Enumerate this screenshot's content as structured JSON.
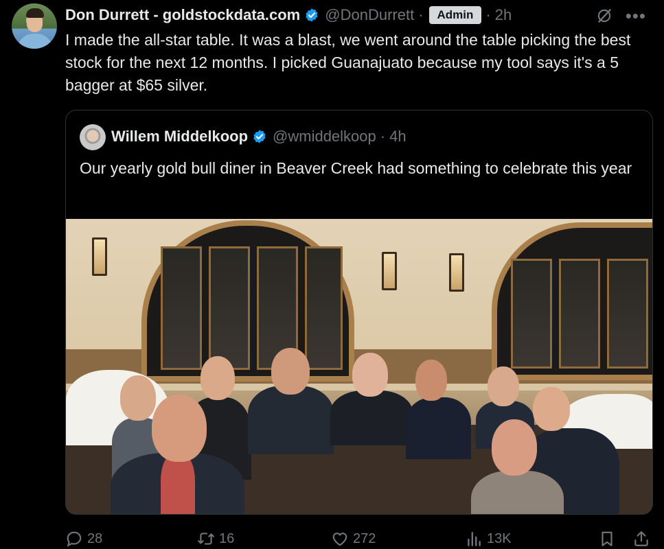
{
  "post": {
    "author_name": "Don Durrett - goldstockdata.com",
    "handle": "@DonDurrett",
    "badge": "Admin",
    "time": "2h",
    "text": "I made the all-star table. It was a blast, we went around the table picking the best stock for the next 12 months. I picked Guanajuato because my tool says it's a 5 bagger at $65 silver."
  },
  "quoted": {
    "author_name": "Willem Middelkoop",
    "handle": "@wmiddelkoop",
    "time": "4h",
    "text": "Our yearly gold bull diner in Beaver Creek had something to celebrate this year"
  },
  "actions": {
    "replies": "28",
    "reposts": "16",
    "likes": "272",
    "views": "13K"
  },
  "colors": {
    "background": "#000000",
    "text": "#e7e9ea",
    "muted": "#71767b",
    "verified": "#1d9bf0",
    "border": "#2f3336"
  },
  "icons": [
    "verified-badge-icon",
    "grok-icon",
    "more-icon",
    "reply-icon",
    "repost-icon",
    "like-icon",
    "views-icon",
    "bookmark-icon",
    "share-icon"
  ]
}
